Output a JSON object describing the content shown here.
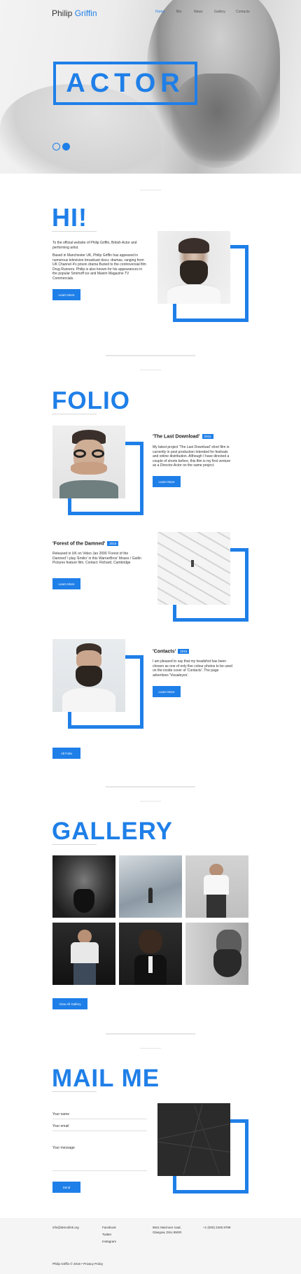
{
  "brand": {
    "first": "Philip",
    "last": "Griffin"
  },
  "nav": [
    "Home",
    "Bio",
    "News",
    "Gallery",
    "Contacts"
  ],
  "hero": {
    "title": "ACTOR"
  },
  "hi": {
    "heading": "HI!",
    "intro": "To the official website of Philip Griffin, British Actor and performing artist.",
    "body": "Based in Manchester UK, Philip Griffin has appeared in numerous television broadcast docu- dramas, ranging from UK Channel 4's prison drama Buried to the controversial film Drug Runners. Philip is also known for his appearances in the popular Smirnoff ice and Maxim Magazine TV Commercials.",
    "button": "Learn More"
  },
  "folio": {
    "heading": "FOLIO",
    "items": [
      {
        "title": "'The Last Download'",
        "year": "2016",
        "text": "My latest project 'The Last Download' short film is currently in post production Intended for festivals and online distribution. Although I have directed a couple of shorts before, this film is my first venture as a Director-Actor on the same project.",
        "button": "Learn More"
      },
      {
        "title": "'Forest of the Damned'",
        "year": "2016",
        "text": "Released in UK on Video Jan 2006 'Forest of the Damned' I play 'Emilio' in this WarnerBros' Moses / Gatlin Pictures feature film. Contact: Richard, Cambridge",
        "button": "Learn More"
      },
      {
        "title": "'Contacts'",
        "year": "2016",
        "text": "I am pleased to say that my headshot has been chosen as one of only five colour photos to be used on the inside cover of 'Contacts'. The page advertises 'Visualeyes'.",
        "button": "Learn More"
      }
    ],
    "all_button": "All Folio"
  },
  "gallery": {
    "heading": "GALLERY",
    "button": "View All Gallery"
  },
  "mail": {
    "heading": "MAIL ME",
    "name_label": "Your name",
    "email_label": "Your email",
    "message_label": "Your message",
    "send": "Send"
  },
  "footer": {
    "email": "info@demolink.org",
    "social": [
      "Facebook",
      "Twitter",
      "Instagram"
    ],
    "address_1": "9641 Marmore road,",
    "address_2": "Glasgow, DSo 89GR",
    "phone": "+1 (000) 2345 8789",
    "copyright": "Philip Griffin © 2016 • Privacy Policy"
  },
  "colors": {
    "accent": "#1f7fe8"
  }
}
